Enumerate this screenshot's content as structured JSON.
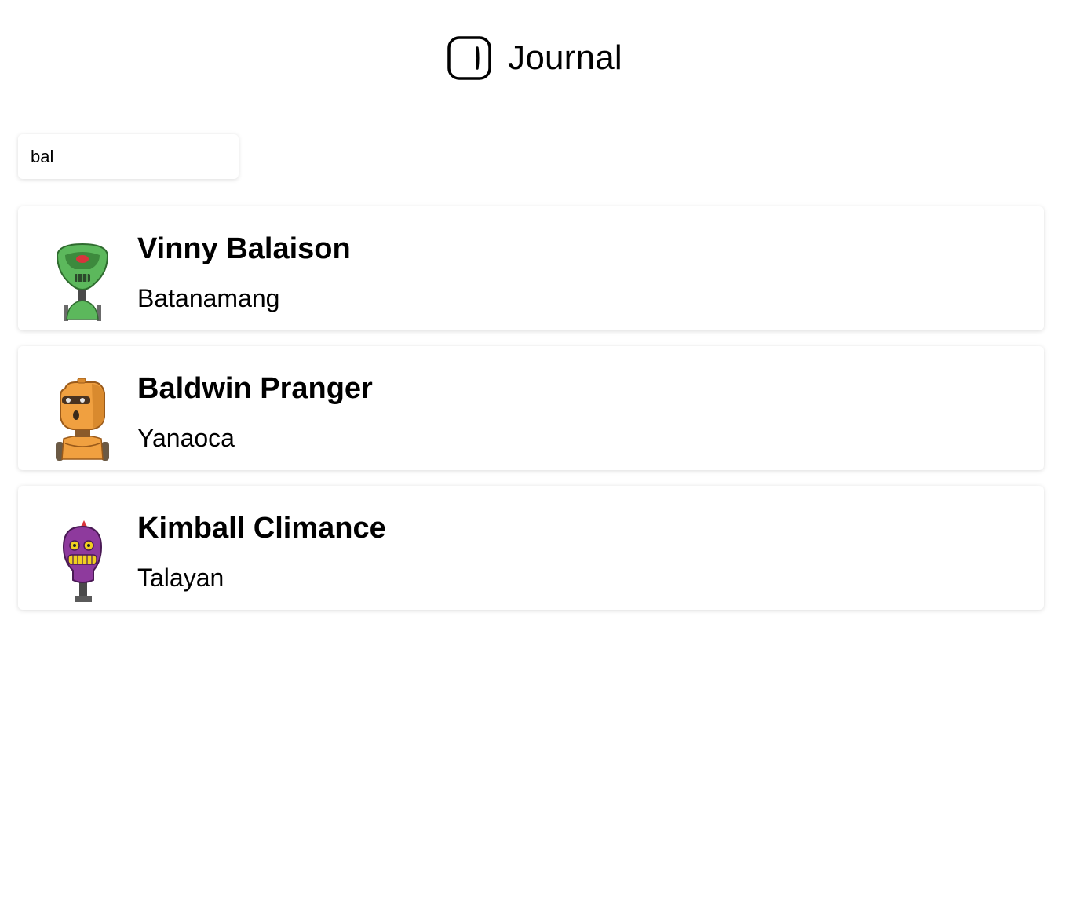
{
  "app": {
    "title": "Journal",
    "logo_icon": "journal-logo-icon"
  },
  "search": {
    "value": "bal",
    "placeholder": ""
  },
  "people": [
    {
      "name": "Vinny Balaison",
      "location": "Batanamang",
      "avatar": "green-robot-avatar",
      "avatar_color": "#5cb85c"
    },
    {
      "name": "Baldwin Pranger",
      "location": "Yanaoca",
      "avatar": "orange-robot-avatar",
      "avatar_color": "#f0a040"
    },
    {
      "name": "Kimball Climance",
      "location": "Talayan",
      "avatar": "purple-robot-avatar",
      "avatar_color": "#8e3a9d"
    }
  ]
}
